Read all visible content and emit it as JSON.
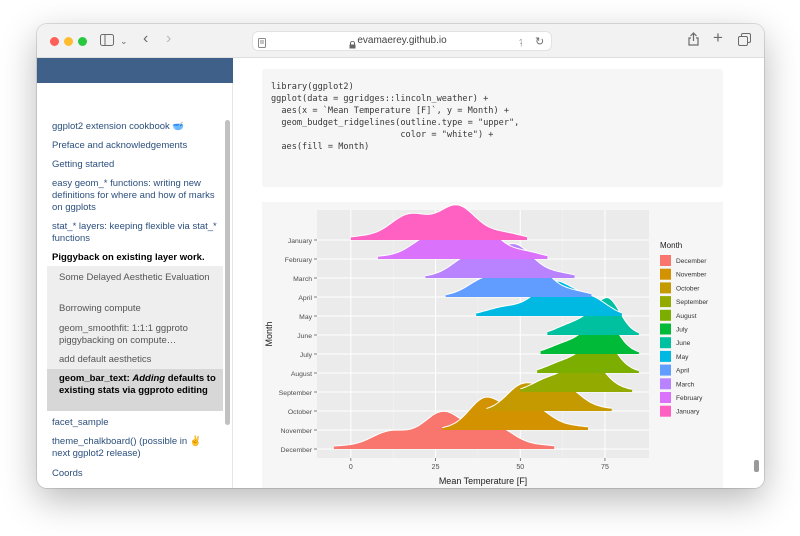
{
  "browser": {
    "url": "evamaerey.github.io"
  },
  "sidebar": {
    "items": [
      {
        "label": "ggplot2 extension cookbook 🥣"
      },
      {
        "label": "Preface and acknowledgements"
      },
      {
        "label": "Getting started"
      },
      {
        "label": "easy geom_* functions: writing new definitions for where and how of marks on ggplots"
      },
      {
        "label": "stat_* layers: keeping flexible via stat_* functions"
      },
      {
        "label": "Piggyback on existing layer work."
      },
      {
        "label": "facet_sample"
      },
      {
        "label": "theme_chalkboard() (possible in ✌️ next ggplot2 release)"
      },
      {
        "label": "Coords"
      }
    ],
    "sub_items": [
      {
        "label": "Some Delayed Aesthetic Evaluation"
      },
      {
        "label": "Borrowing compute"
      },
      {
        "label": "geom_smoothfit: 1:1:1 ggproto piggybacking on compute…"
      },
      {
        "label": "add default aesthetics"
      },
      {
        "label_prefix": "geom_bar_text: ",
        "label_em": "Adding",
        "label_suffix": " defaults to existing stats via ggproto editing"
      }
    ]
  },
  "code": {
    "lines": [
      "library(ggplot2)",
      "ggplot(data = ggridges::lincoln_weather) +",
      "  aes(x = `Mean Temperature [F]`, y = Month) +",
      "  geom_budget_ridgelines(outline.type = \"upper\",",
      "                         color = \"white\") +",
      "  aes(fill = Month)"
    ]
  },
  "chart_data": {
    "type": "area",
    "xlabel": "Mean Temperature [F]",
    "ylabel": "Month",
    "x_ticks": [
      0,
      25,
      50,
      75
    ],
    "xlim": [
      -10,
      88
    ],
    "legend_title": "Month",
    "legend_position": "right",
    "grid": true,
    "categories": [
      "January",
      "February",
      "March",
      "April",
      "May",
      "June",
      "July",
      "August",
      "September",
      "October",
      "November",
      "December"
    ],
    "series": [
      {
        "name": "January",
        "color": "#FF61C3",
        "peak": 27,
        "min": 0,
        "max": 52
      },
      {
        "name": "February",
        "color": "#DB72FB",
        "peak": 34,
        "min": 8,
        "max": 58
      },
      {
        "name": "March",
        "color": "#B983FF",
        "peak": 44,
        "min": 22,
        "max": 66
      },
      {
        "name": "April",
        "color": "#619CFF",
        "peak": 50,
        "min": 28,
        "max": 71
      },
      {
        "name": "May",
        "color": "#00B9E3",
        "peak": 65,
        "min": 37,
        "max": 80
      },
      {
        "name": "June",
        "color": "#00C19F",
        "peak": 75,
        "min": 58,
        "max": 85
      },
      {
        "name": "July",
        "color": "#00BA38",
        "peak": 74,
        "min": 56,
        "max": 85
      },
      {
        "name": "August",
        "color": "#7CAE00",
        "peak": 73,
        "min": 55,
        "max": 85
      },
      {
        "name": "September",
        "color": "#93AA00",
        "peak": 68,
        "min": 50,
        "max": 83
      },
      {
        "name": "October",
        "color": "#C49A00",
        "peak": 55,
        "min": 40,
        "max": 77
      },
      {
        "name": "November",
        "color": "#D39200",
        "peak": 43,
        "min": 27,
        "max": 70
      },
      {
        "name": "December",
        "color": "#F8766D",
        "peak": 30,
        "min": -5,
        "max": 60
      }
    ]
  }
}
